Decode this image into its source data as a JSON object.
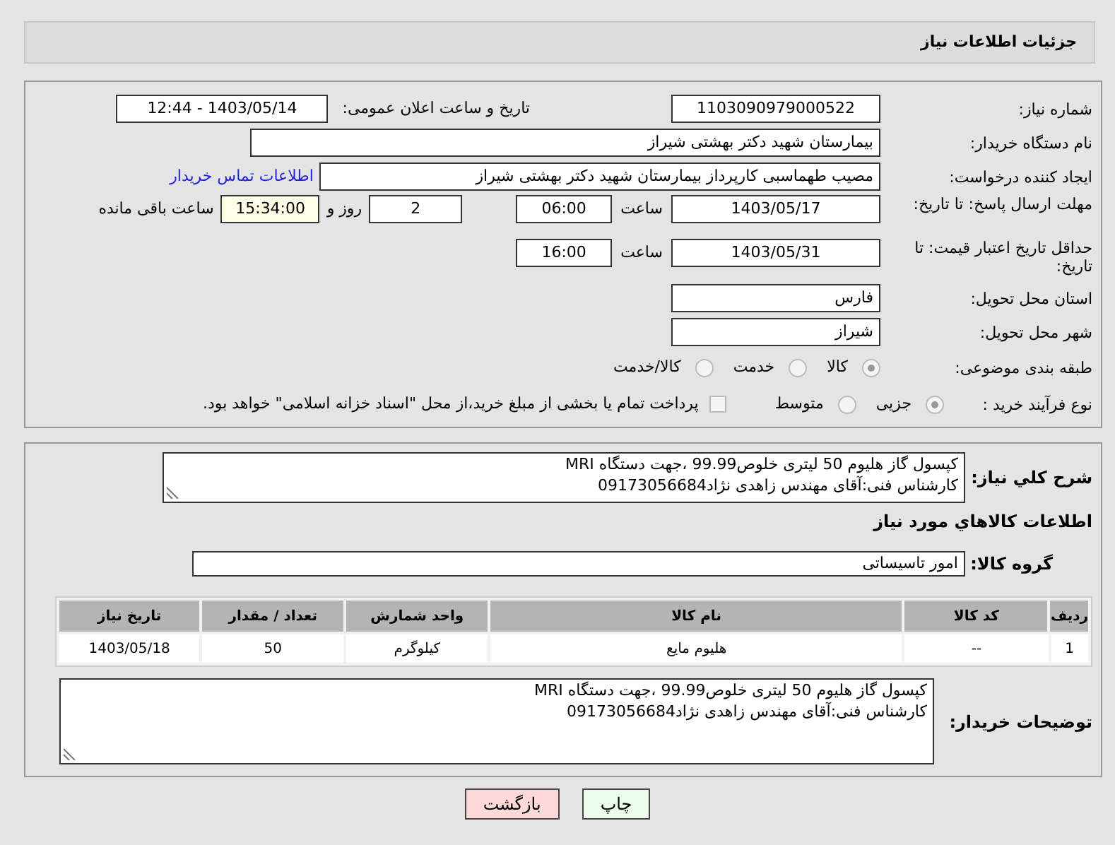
{
  "header": {
    "title": "جزئیات اطلاعات نیاز"
  },
  "fields": {
    "need_number": {
      "label": "شماره نیاز:",
      "value": "1103090979000522"
    },
    "announce": {
      "label": "تاریخ و ساعت اعلان عمومی:",
      "value": "1403/05/14 - 12:44"
    },
    "buyer_org": {
      "label": "نام دستگاه خریدار:",
      "value": "بیمارستان شهید دکتر بهشتی شیراز"
    },
    "creator": {
      "label": "ایجاد کننده درخواست:",
      "value": "مصیب طهماسبی کارپرداز بیمارستان شهید دکتر بهشتی شیراز",
      "link": "اطلاعات تماس خریدار"
    },
    "deadline": {
      "label": "مهلت ارسال پاسخ: تا تاریخ:",
      "date": "1403/05/17",
      "time_label": "ساعت",
      "time": "06:00",
      "days": "2",
      "days_label": "روز و",
      "remaining": "15:34:00",
      "remaining_label": "ساعت باقی مانده"
    },
    "validity": {
      "label": "حداقل تاریخ اعتبار قیمت: تا تاریخ:",
      "date": "1403/05/31",
      "time_label": "ساعت",
      "time": "16:00"
    },
    "province": {
      "label": "استان محل تحویل:",
      "value": "فارس"
    },
    "city": {
      "label": "شهر محل تحویل:",
      "value": "شیراز"
    },
    "category": {
      "label": "طبقه بندی موضوعی:",
      "options": [
        {
          "label": "کالا",
          "selected": true
        },
        {
          "label": "خدمت",
          "selected": false
        },
        {
          "label": "کالا/خدمت",
          "selected": false
        }
      ]
    },
    "process": {
      "label": "نوع فرآیند خرید :",
      "options": [
        {
          "label": "جزیی",
          "selected": true
        },
        {
          "label": "متوسط",
          "selected": false
        }
      ],
      "payment": {
        "label": "پرداخت تمام یا بخشی از مبلغ خرید،از محل \"اسناد خزانه اسلامی\" خواهد بود.",
        "checked": false
      }
    }
  },
  "details": {
    "description": {
      "label": "شرح کلي نياز:",
      "value": "کپسول گاز هلیوم 50 لیتری خلوص99.99 ،جهت دستگاه MRI\nکارشناس فنی:آقای مهندس زاهدی نژاد09173056684"
    },
    "goods_heading": "اطلاعات کالاهاي مورد نياز",
    "group": {
      "label": "گروه کالا:",
      "value": "امور تاسیساتی"
    },
    "table": {
      "columns": [
        "ردیف",
        "کد کالا",
        "نام کالا",
        "واحد شمارش",
        "تعداد / مقدار",
        "تاریخ نیاز"
      ],
      "rows": [
        [
          "1",
          "--",
          "هلیوم مایع",
          "کیلوگرم",
          "50",
          "1403/05/18"
        ]
      ]
    },
    "buyer_notes": {
      "label": "توضیحات خریدار:",
      "value": "کپسول گاز هلیوم 50 لیتری خلوص99.99 ،جهت دستگاه MRI\nکارشناس فنی:آقای مهندس زاهدی نژاد09173056684"
    }
  },
  "buttons": [
    {
      "label": "چاپ",
      "kind": "print"
    },
    {
      "label": "بازگشت",
      "kind": "back"
    }
  ]
}
